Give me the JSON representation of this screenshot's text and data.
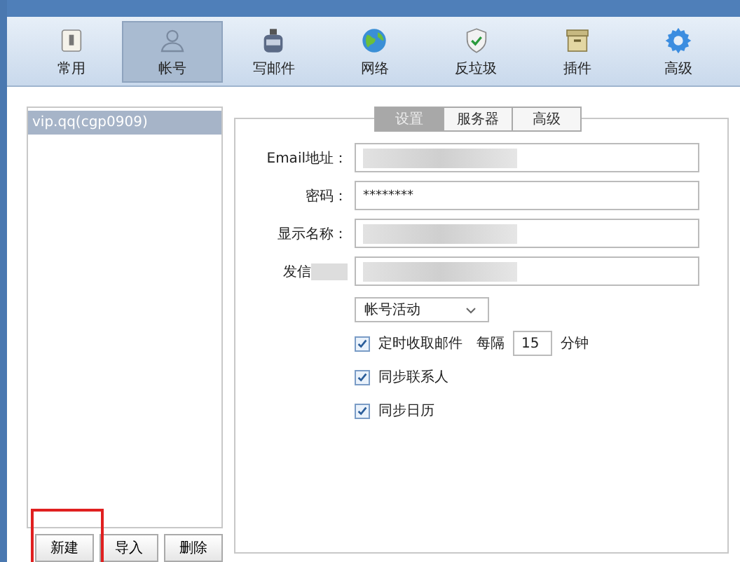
{
  "toolbar": [
    {
      "label": "常用",
      "selected": false
    },
    {
      "label": "帐号",
      "selected": true
    },
    {
      "label": "写邮件",
      "selected": false
    },
    {
      "label": "网络",
      "selected": false
    },
    {
      "label": "反垃圾",
      "selected": false
    },
    {
      "label": "插件",
      "selected": false
    },
    {
      "label": "高级",
      "selected": false
    }
  ],
  "accounts": [
    {
      "label": "vip.qq(cgp0909)",
      "selected": true
    }
  ],
  "account_buttons": [
    {
      "label": "新建",
      "highlighted": true
    },
    {
      "label": "导入",
      "highlighted": false
    },
    {
      "label": "删除",
      "highlighted": false
    }
  ],
  "tabs": [
    {
      "label": "设置",
      "selected": true
    },
    {
      "label": "服务器",
      "selected": false
    },
    {
      "label": "高级",
      "selected": false
    }
  ],
  "fields": [
    {
      "label": "Email地址：",
      "blurred": true
    },
    {
      "label": "密码：",
      "value": "********",
      "blurred": false
    },
    {
      "label": "显示名称：",
      "blurred": true
    },
    {
      "label": "发信",
      "blurred": true
    }
  ],
  "status_select": {
    "value": "帐号活动"
  },
  "options": [
    {
      "label": "定时收取邮件",
      "checked": true,
      "interval_label": "每隔",
      "interval": "15",
      "unit": "分钟"
    },
    {
      "label": "同步联系人",
      "checked": true
    },
    {
      "label": "同步日历",
      "checked": true
    }
  ]
}
